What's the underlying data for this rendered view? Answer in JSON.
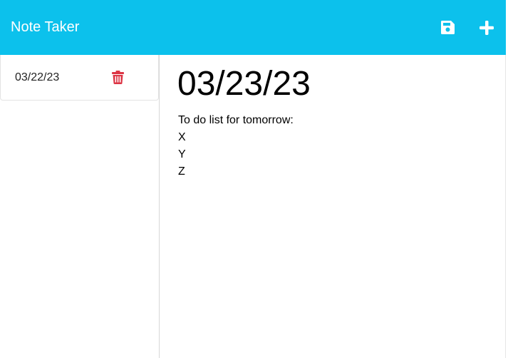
{
  "app": {
    "title": "Note Taker",
    "accent_color": "#0cc1ec"
  },
  "toolbar": {
    "save_icon": "save-icon",
    "new_icon": "plus-icon"
  },
  "sidebar": {
    "notes": [
      {
        "title": "03/22/23",
        "delete_icon": "trash-icon",
        "delete_color": "#dc3545"
      }
    ]
  },
  "editor": {
    "title": "03/23/23",
    "lines": [
      "To do list for tomorrow:",
      "X",
      "Y",
      "Z"
    ]
  }
}
